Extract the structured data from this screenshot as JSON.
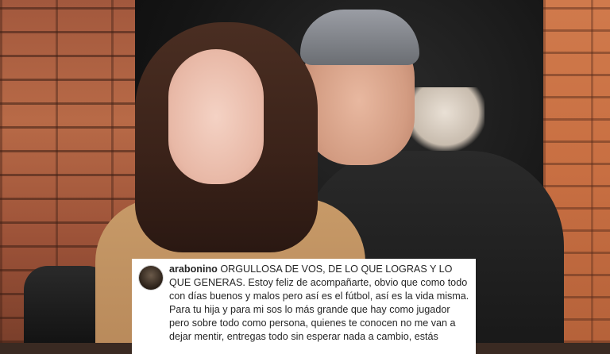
{
  "post": {
    "username": "arabonino",
    "caption": "ORGULLOSA DE VOS, DE LO QUE LOGRAS Y LO QUE GENERAS. Estoy feliz de acompañarte, obvio que como todo con días buenos y malos pero así es el fútbol, así es la vida misma. Para tu hija y para mi sos lo más grande que hay como jugador pero sobre todo como persona, quienes te conocen no me van a dejar mentir, entregas todo sin esperar nada a cambio, estás"
  }
}
